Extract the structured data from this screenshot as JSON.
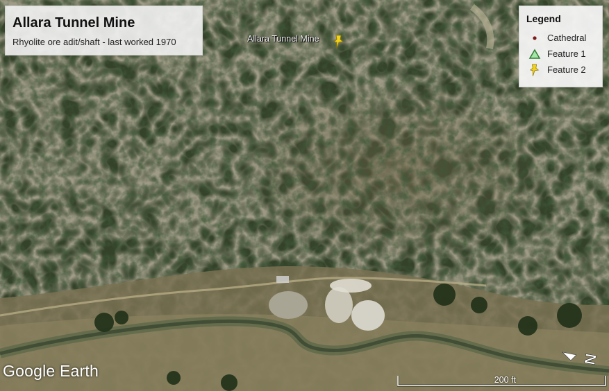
{
  "title_box": {
    "title": "Allara Tunnel Mine",
    "subtitle": "Rhyolite ore adit/shaft - last worked 1970"
  },
  "legend": {
    "heading": "Legend",
    "items": [
      {
        "label": "Cathedral",
        "icon": "dot-icon",
        "color": "#7a1a1a"
      },
      {
        "label": "Feature 1",
        "icon": "triangle-icon",
        "color": "#4caf50"
      },
      {
        "label": "Feature 2",
        "icon": "pushpin-icon",
        "color": "#f2d21b"
      }
    ]
  },
  "placemark": {
    "label": "Allara Tunnel Mine",
    "icon": "pushpin-icon",
    "color": "#f2d21b"
  },
  "branding": {
    "text": "Google Earth"
  },
  "scale_bar": {
    "label": "200 ft"
  },
  "compass": {
    "icon": "north-arrow-icon",
    "letter": "N"
  }
}
